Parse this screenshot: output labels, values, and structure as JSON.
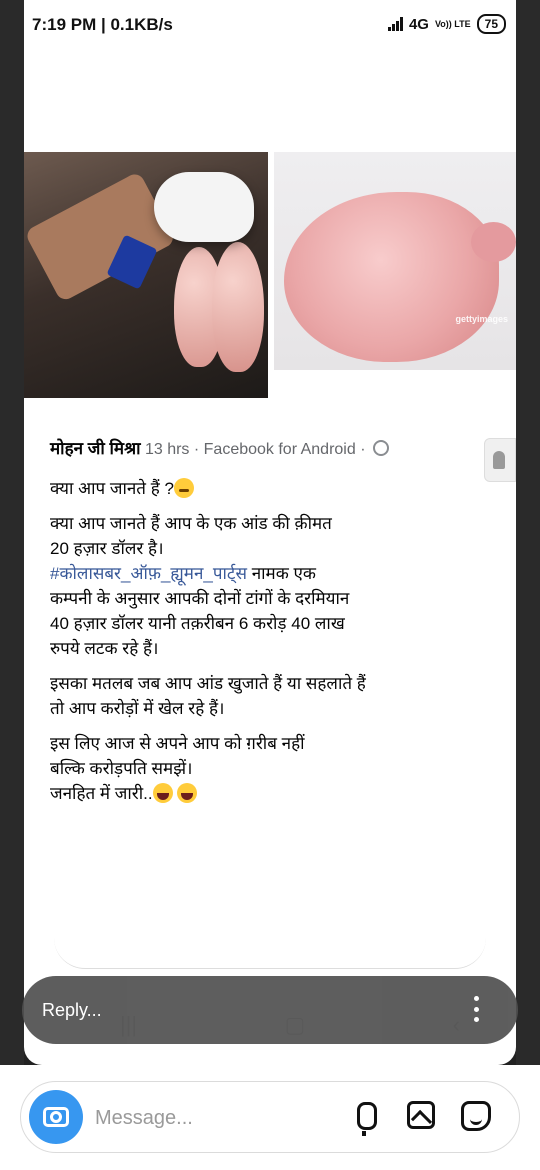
{
  "status": {
    "time": "7:19 PM | 0.1KB/s",
    "network": "4G",
    "volte": "Vo)) LTE",
    "battery": "75"
  },
  "post": {
    "author": "मोहन जी मिश्रा",
    "meta": " 13 hrs · Facebook for Android · ",
    "line1": "क्या आप जानते हैं ?",
    "line2a": "क्या आप जानते हैं आप के एक आंड की क़ीमत",
    "line2b": "20 हज़ार डॉलर है।",
    "hashtag": "#कोलासबर_ऑफ़_ह्यूमन_पार्ट्स",
    "line3a": " नामक एक",
    "line3b": "कम्पनी के अनुसार आपकी दोनों टांगों के दरमियान",
    "line3c": "40 हज़ार डॉलर यानी तक़रीबन 6 करोड़ 40 लाख",
    "line3d": "रुपये लटक रहे हैं।",
    "line4a": "इसका मतलब जब आप आंड खुजाते हैं या सहलाते हैं",
    "line4b": "तो आप करोड़ों में खेल रहे हैं।",
    "line5a": "इस लिए आज से अपने आप को ग़रीब नहीं",
    "line5b": "बल्कि करोड़पति समझें।",
    "line6": "जनहित में जारी.."
  },
  "images": {
    "watermark": "gettyimages"
  },
  "reply": {
    "placeholder": "Reply..."
  },
  "composer": {
    "placeholder": "Message..."
  }
}
